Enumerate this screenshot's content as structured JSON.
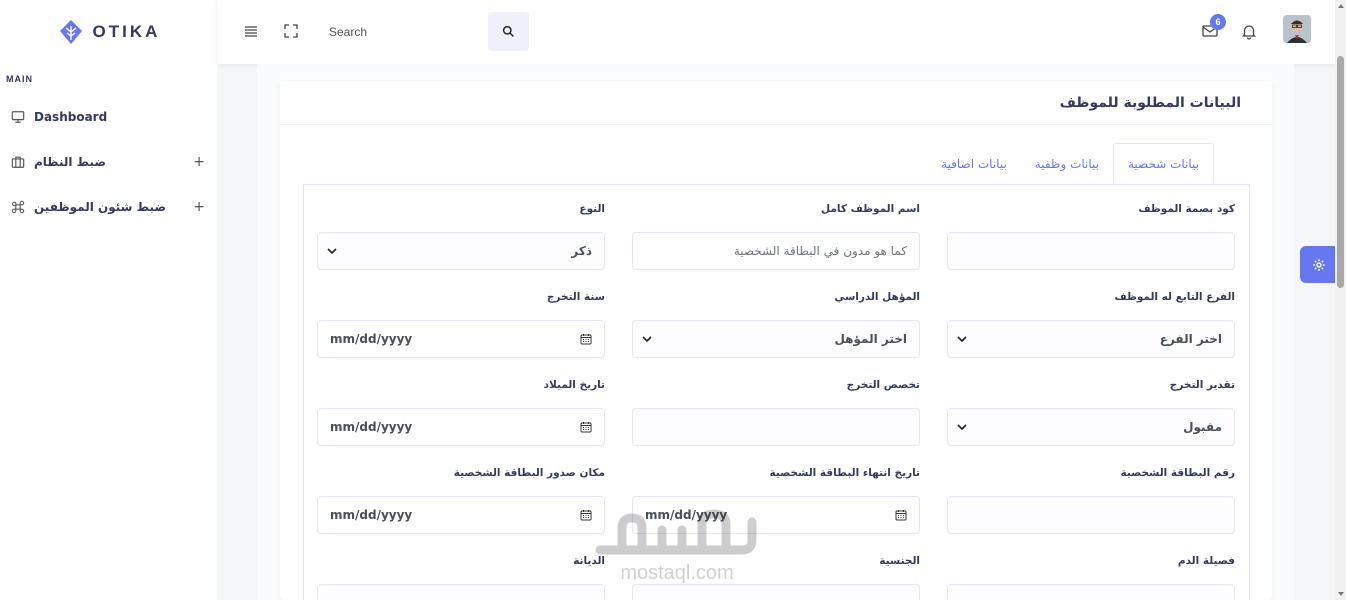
{
  "brand": {
    "name": "OTIKA",
    "color": "#6777ef"
  },
  "sidebar": {
    "section": "MAIN",
    "items": [
      {
        "label": "Dashboard",
        "icon": "monitor-icon",
        "expandable": false
      },
      {
        "label": "ضبط النظام",
        "icon": "briefcase-icon",
        "expandable": true,
        "toggle": "+"
      },
      {
        "label": "ضبط شئون الموظفين",
        "icon": "command-icon",
        "expandable": true,
        "toggle": "+"
      }
    ]
  },
  "navbar": {
    "search_placeholder": "Search",
    "mail_badge": "6",
    "icons": [
      "menu-icon",
      "fullscreen-icon",
      "search-icon",
      "mail-icon",
      "bell-icon"
    ]
  },
  "card": {
    "title": "البيانات المطلوبة للموظف",
    "tabs": [
      {
        "label": "بيانات شخصية",
        "active": true
      },
      {
        "label": "بيانات وظفية",
        "active": false
      },
      {
        "label": "بيانات اضافية",
        "active": false
      }
    ],
    "fields": [
      {
        "label": "كود بصمة الموظف",
        "type": "input",
        "value": ""
      },
      {
        "label": "اسم الموظف كامل",
        "type": "input",
        "placeholder": "كما هو مدون في البطاقة الشخصية"
      },
      {
        "label": "النوع",
        "type": "select",
        "value": "ذكر"
      },
      {
        "label": "الفرع التابع له الموظف",
        "type": "select",
        "value": "اختر الفرع"
      },
      {
        "label": "المؤهل الدراسي",
        "type": "select",
        "value": "اختر المؤهل"
      },
      {
        "label": "سنة التخرج",
        "type": "date",
        "value": "mm/dd/yyyy"
      },
      {
        "label": "تقدير التخرج",
        "type": "select",
        "value": "مقبول"
      },
      {
        "label": "تخصص التخرج",
        "type": "input",
        "value": ""
      },
      {
        "label": "تاريخ الميلاد",
        "type": "date",
        "value": "mm/dd/yyyy"
      },
      {
        "label": "رقم البطاقة الشخصية",
        "type": "input",
        "value": ""
      },
      {
        "label": "تاريخ انتهاء البطاقة الشخصية",
        "type": "date",
        "value": "mm/dd/yyyy"
      },
      {
        "label": "مكان صدور البطاقة الشخصية",
        "type": "date",
        "value": "mm/dd/yyyy"
      },
      {
        "label": "فصيلة الدم",
        "type": "select",
        "value": ""
      },
      {
        "label": "الجنسية",
        "type": "select",
        "value": ""
      },
      {
        "label": "الديانة",
        "type": "select",
        "value": ""
      }
    ]
  },
  "watermark": {
    "text": "mostaql.com"
  },
  "colors": {
    "accent": "#6777ef",
    "text": "#34395e",
    "border": "#e4e6fc"
  }
}
